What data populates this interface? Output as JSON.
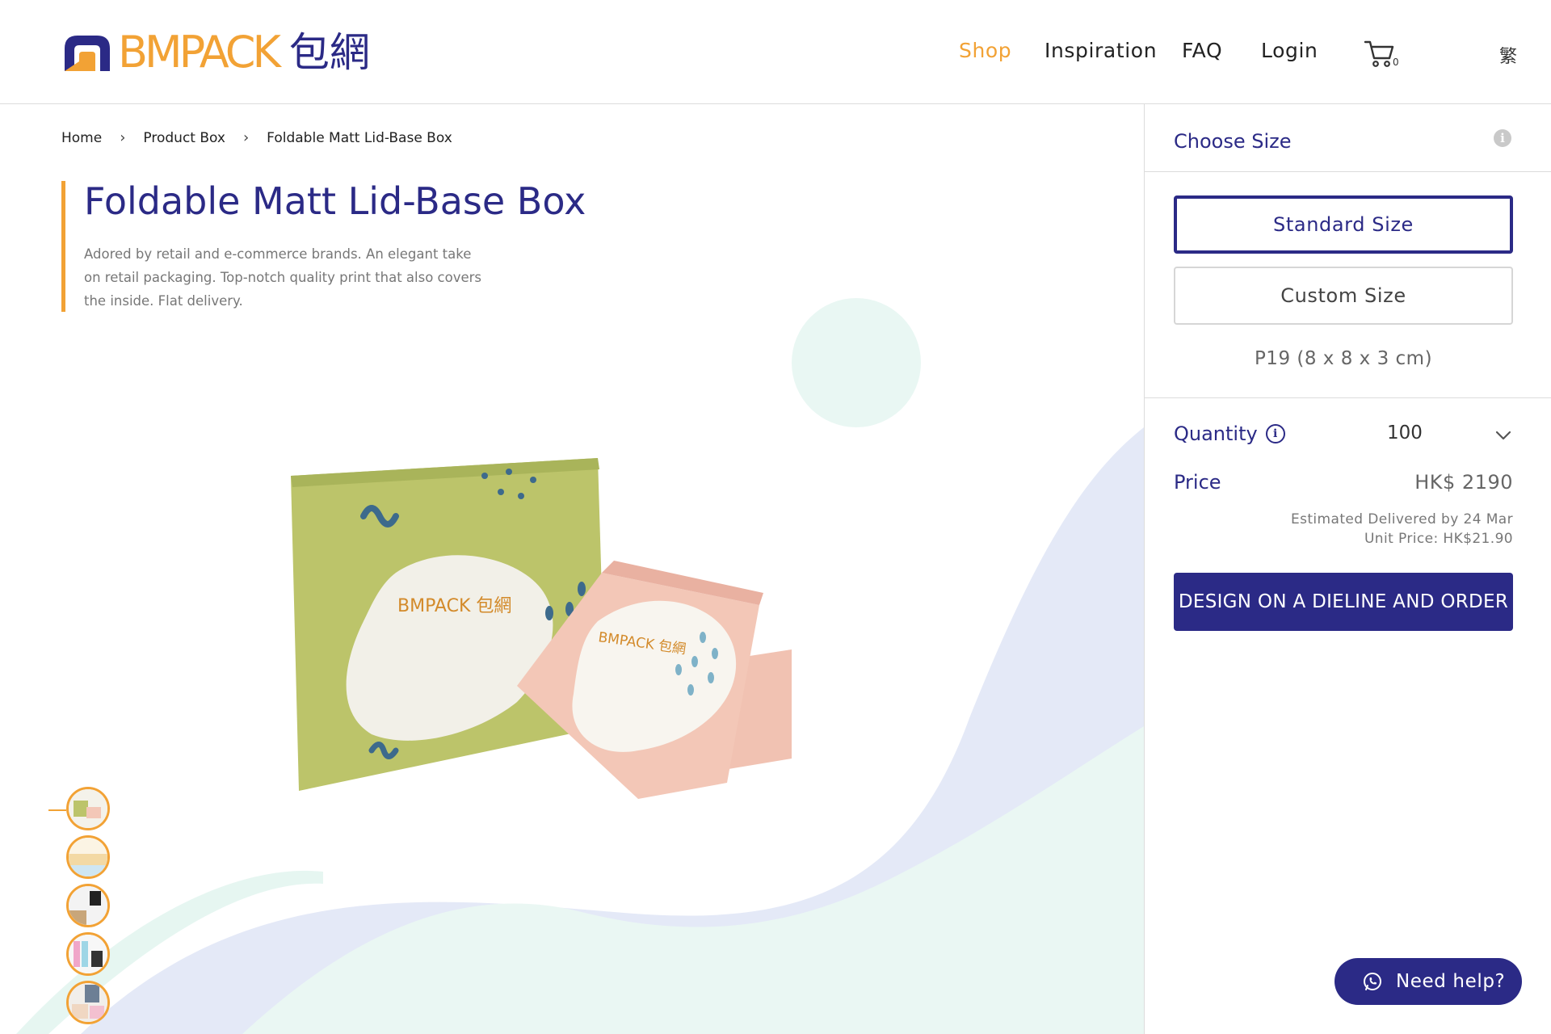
{
  "brand": {
    "name": "BMPACK",
    "name_cn": "包網",
    "colors": {
      "primary": "#2b2a86",
      "accent": "#f2a235"
    }
  },
  "nav": {
    "items": [
      {
        "label": "Shop",
        "active": true
      },
      {
        "label": "Inspiration"
      },
      {
        "label": "FAQ"
      },
      {
        "label": "Login"
      }
    ],
    "cart_icon": "shopping-cart-icon",
    "cart_count": "0",
    "language_toggle": "繁"
  },
  "breadcrumb": {
    "items": [
      "Home",
      "Product Box",
      "Foldable Matt Lid-Base Box"
    ]
  },
  "product": {
    "title": "Foldable Matt Lid-Base Box",
    "description": "Adored by retail and e-commerce brands. An elegant take on retail packaging. Top-notch quality print that also covers the inside. Flat delivery.",
    "image_logo_text": "BMPACK 包網",
    "thumbnails": [
      "thumbnail-1",
      "thumbnail-2",
      "thumbnail-3",
      "thumbnail-4",
      "thumbnail-5"
    ],
    "active_thumbnail": 0
  },
  "sidebar": {
    "choose_size_label": "Choose Size",
    "size_options": [
      {
        "label": "Standard Size",
        "selected": true
      },
      {
        "label": "Custom Size",
        "selected": false
      }
    ],
    "size_code": "P19 (8 x 8 x 3 cm)",
    "quantity_label": "Quantity",
    "quantity_value": "100",
    "price_label": "Price",
    "price_value": "HK$ 2190",
    "estimated_delivery": "Estimated Delivered by 24 Mar",
    "unit_price": "Unit Price: HK$21.90",
    "order_button": "DESIGN ON A DIELINE AND ORDER"
  },
  "help_button": {
    "label": "Need help?",
    "icon": "whatsapp-icon"
  }
}
